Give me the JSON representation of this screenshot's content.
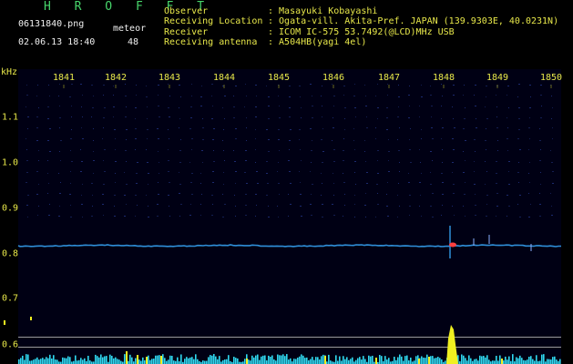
{
  "header": {
    "app_title": "H R O F F T",
    "file_name": "06131840.png",
    "meteor_label": "meteor",
    "date_time": "02.06.13 18:40",
    "meteor_count": "48"
  },
  "info": {
    "observer_label": "Observer",
    "observer_value": ": Masayuki Kobayashi",
    "location_label": "Receiving Location",
    "location_value": ": Ogata-vill. Akita-Pref. JAPAN (139.9303E, 40.0231N)",
    "receiver_label": "Receiver",
    "receiver_value": ": ICOM IC-575 53.7492(@LCD)MHz USB",
    "antenna_label": "Receiving antenna",
    "antenna_value": ": A504HB(yagi 4el)"
  },
  "axis": {
    "unit": "kHz",
    "time_ticks": [
      "1841",
      "1842",
      "1843",
      "1844",
      "1845",
      "1846",
      "1847",
      "1848",
      "1849",
      "1850"
    ],
    "freq_ticks": [
      "1.1",
      "1.0",
      "0.9",
      "0.8",
      "0.7",
      "0.6"
    ]
  },
  "colors": {
    "text": "#e8e84a",
    "title": "#47d56b",
    "signal": "#2f8fd8",
    "echo_core": "#ff4040",
    "bar_yellow": "#f0f020",
    "bar_cyan": "#30d8f0"
  }
}
